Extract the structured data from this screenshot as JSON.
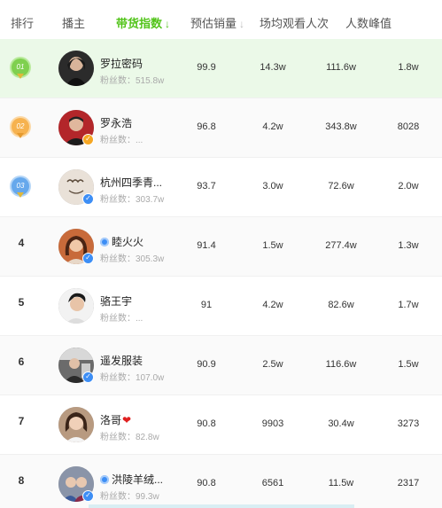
{
  "header": {
    "rank": "排行",
    "streamer": "播主",
    "score": "带货指数",
    "sales": "预估销量",
    "views": "场均观看人次",
    "peak": "人数峰值"
  },
  "fans_label": "粉丝数：",
  "rows": [
    {
      "rank": "01",
      "name": "罗拉密码",
      "fans": "515.8w",
      "score": "99.9",
      "sales": "14.3w",
      "views": "111.6w",
      "peak": "1.8w"
    },
    {
      "rank": "02",
      "name": "罗永浩",
      "fans": "...",
      "score": "96.8",
      "sales": "4.2w",
      "views": "343.8w",
      "peak": "8028"
    },
    {
      "rank": "03",
      "name": "杭州四季青...",
      "fans": "303.7w",
      "score": "93.7",
      "sales": "3.0w",
      "views": "72.6w",
      "peak": "2.0w"
    },
    {
      "rank": "4",
      "name": "睦火火",
      "fans": "305.3w",
      "score": "91.4",
      "sales": "1.5w",
      "views": "277.4w",
      "peak": "1.3w"
    },
    {
      "rank": "5",
      "name": "骆王宇",
      "fans": "...",
      "score": "91",
      "sales": "4.2w",
      "views": "82.6w",
      "peak": "1.7w"
    },
    {
      "rank": "6",
      "name": "遥发服装",
      "fans": "107.0w",
      "score": "90.9",
      "sales": "2.5w",
      "views": "116.6w",
      "peak": "1.5w"
    },
    {
      "rank": "7",
      "name": "洛哥",
      "fans": "82.8w",
      "score": "90.8",
      "sales": "9903",
      "views": "30.4w",
      "peak": "3273"
    },
    {
      "rank": "8",
      "name": "洪陵羊绒...",
      "fans": "99.3w",
      "score": "90.8",
      "sales": "6561",
      "views": "11.5w",
      "peak": "2317"
    }
  ],
  "colors": {
    "accent": "#52c41a",
    "first_row_bg": "#ebf9e8",
    "verify_blue": "#3d8ef5",
    "verify_orange": "#f5a623"
  },
  "icons": {
    "sort_active": "sort-down-arrow-icon",
    "sort_inactive": "sort-down-arrow-icon",
    "medal_1": "gold-medal-icon",
    "medal_2": "silver-medal-icon",
    "medal_3": "bronze-medal-icon",
    "verified": "verified-check-icon",
    "heart": "heart-icon"
  }
}
